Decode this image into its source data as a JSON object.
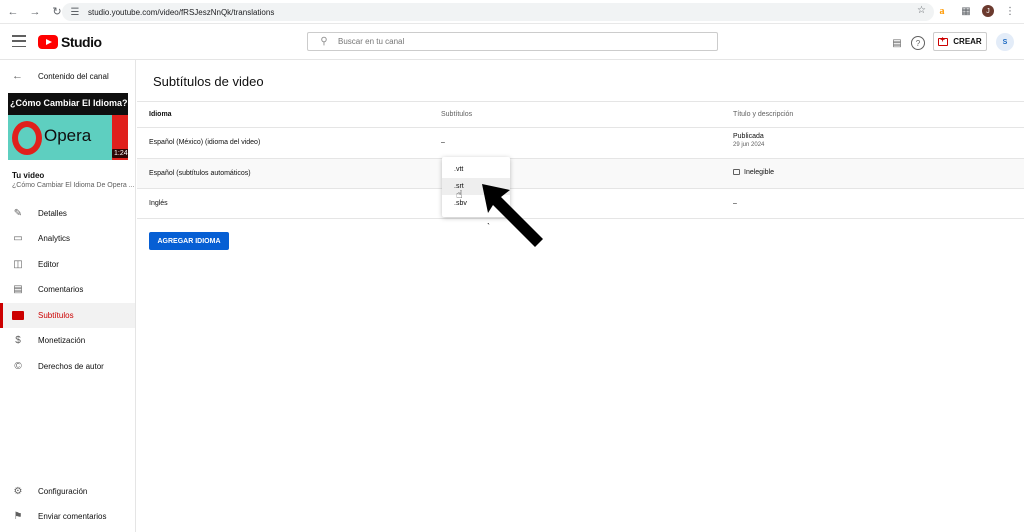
{
  "browser": {
    "url": "studio.youtube.com/video/fRSJeszNnQk/translations",
    "profile_initial": "J",
    "icons": [
      "back-icon",
      "forward-icon",
      "reload-icon",
      "site-info-icon",
      "star-icon",
      "amazon-extension-icon",
      "extensions-icon",
      "profile-avatar",
      "more-icon"
    ]
  },
  "header": {
    "logo_text": "Studio",
    "search_placeholder": "Buscar en tu canal",
    "create_label": "CREAR",
    "colors": {
      "brand": "#ff0000",
      "accent": "#065fd4",
      "active": "#cc0000"
    }
  },
  "sidebar": {
    "back_label": "Contenido del canal",
    "thumbnail": {
      "title": "¿Cómo Cambiar El Idioma?",
      "brand": "Opera",
      "duration": "1:24"
    },
    "your_video_label": "Tu video",
    "video_name": "¿Cómo Cambiar El Idioma De Opera ...",
    "items": [
      {
        "label": "Detalles",
        "icon": "pencil-icon"
      },
      {
        "label": "Analytics",
        "icon": "analytics-icon"
      },
      {
        "label": "Editor",
        "icon": "editor-icon"
      },
      {
        "label": "Comentarios",
        "icon": "comments-icon"
      },
      {
        "label": "Subtítulos",
        "icon": "subtitles-icon",
        "active": true
      },
      {
        "label": "Monetización",
        "icon": "dollar-icon"
      },
      {
        "label": "Derechos de autor",
        "icon": "copyright-icon"
      }
    ],
    "footer_items": [
      {
        "label": "Configuración",
        "icon": "gear-icon"
      },
      {
        "label": "Enviar comentarios",
        "icon": "feedback-icon"
      }
    ]
  },
  "main": {
    "title": "Subtítulos de video",
    "columns": [
      "Idioma",
      "Subtítulos",
      "Título y descripción"
    ],
    "rows": [
      {
        "language": "Español (México) (idioma del video)",
        "subtitles": "–",
        "title_status": "Publicada",
        "title_date": "29 jun 2024"
      },
      {
        "language": "Español (subtítulos automáticos)",
        "subtitles": "",
        "title_status": "Inelegible"
      },
      {
        "language": "Inglés",
        "subtitles": "",
        "title_status": "–"
      }
    ],
    "add_language_label": "AGREGAR IDIOMA",
    "format_menu": [
      ".vtt",
      ".srt",
      ".sbv"
    ],
    "hovered_format": ".srt"
  }
}
